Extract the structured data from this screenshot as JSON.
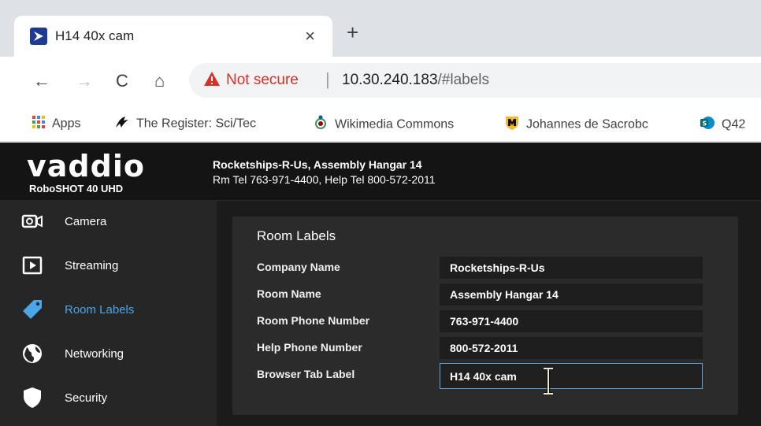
{
  "browser": {
    "tab_title": "H14 40x cam",
    "tab_close": "×",
    "new_tab": "+",
    "nav": {
      "back": "←",
      "forward": "→",
      "reload": "C",
      "home": "⌂"
    },
    "security_label": "Not secure",
    "separator": "|",
    "url_host": "10.30.240.183",
    "url_path": "/#labels",
    "bookmarks": [
      {
        "label": "Apps",
        "icon": "apps-grid-icon"
      },
      {
        "label": "The Register: Sci/Tec",
        "icon": "register-logo-icon"
      },
      {
        "label": "Wikimedia Commons",
        "icon": "wikimedia-logo-icon"
      },
      {
        "label": "Johannes de Sacrobc",
        "icon": "shield-logo-icon"
      },
      {
        "label": "Q42",
        "icon": "sharepoint-icon"
      }
    ]
  },
  "app": {
    "logo": "vaddio",
    "product": "RoboSHOT 40 UHD",
    "location_line1": "Rocketships-R-Us, Assembly Hangar 14",
    "location_line2": "Rm Tel 763-971-4400, Help Tel 800-572-2011",
    "accent_color": "#4aa6e8",
    "sidebar": [
      {
        "label": "Camera",
        "icon": "camera-icon"
      },
      {
        "label": "Streaming",
        "icon": "play-icon"
      },
      {
        "label": "Room Labels",
        "icon": "tag-icon",
        "active": true
      },
      {
        "label": "Networking",
        "icon": "globe-icon"
      },
      {
        "label": "Security",
        "icon": "shield-icon"
      }
    ],
    "panel": {
      "title": "Room Labels",
      "fields": [
        {
          "label": "Company Name",
          "value": "Rocketships-R-Us"
        },
        {
          "label": "Room Name",
          "value": "Assembly Hangar 14"
        },
        {
          "label": "Room Phone Number",
          "value": "763-971-4400"
        },
        {
          "label": "Help Phone Number",
          "value": "800-572-2011"
        },
        {
          "label": "Browser Tab Label",
          "value": "H14 40x cam",
          "focused": true
        }
      ]
    }
  }
}
